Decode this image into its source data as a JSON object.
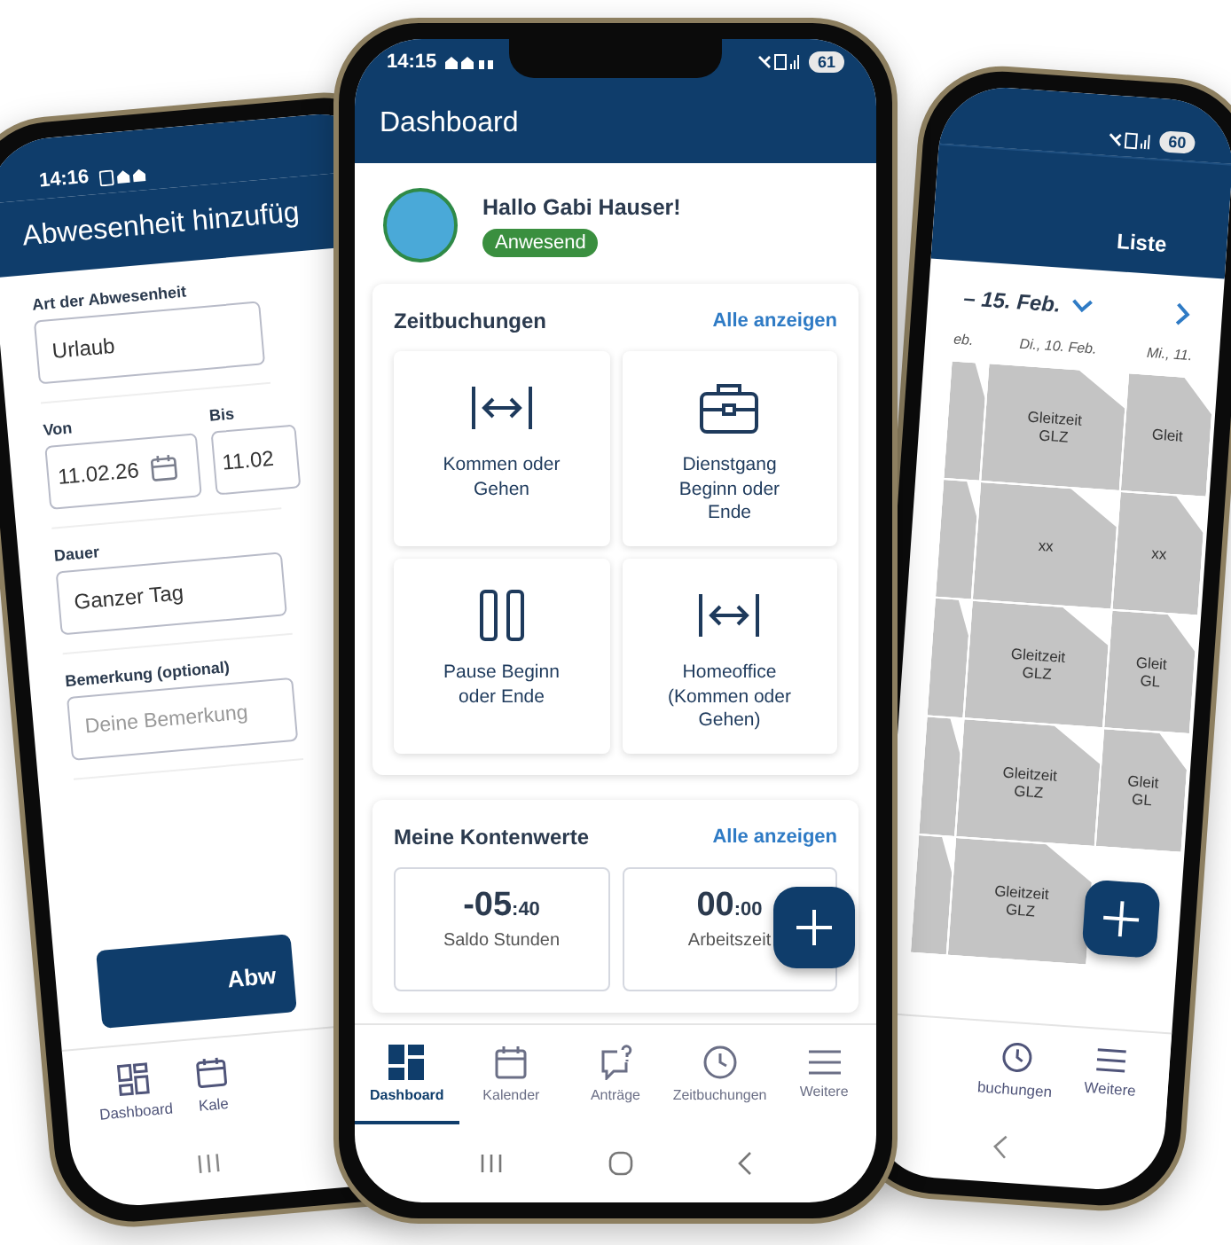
{
  "left_phone": {
    "status_time": "14:16",
    "title": "Abwesenheit hinzufüg",
    "field_rows": [
      [
        {
          "label": "Art der Abwesenheit",
          "value": "Urlaub",
          "kind": "text"
        }
      ],
      [
        {
          "label": "Von",
          "value": "11.02.26",
          "kind": "date"
        },
        {
          "label": "Bis",
          "value": "11.02",
          "kind": "text"
        }
      ],
      [
        {
          "label": "Dauer",
          "value": "Ganzer Tag",
          "kind": "text"
        }
      ],
      [
        {
          "label": "Bemerkung (optional)",
          "placeholder": "Deine Bemerkung"
        }
      ]
    ],
    "button": "Abw",
    "nav": [
      "Dashboard",
      "Kale"
    ]
  },
  "center_phone": {
    "status_time": "14:15",
    "battery": "61",
    "title": "Dashboard",
    "greeting": "Hallo Gabi Hauser!",
    "presence": "Anwesend",
    "sections": [
      {
        "kind": "actions",
        "title": "Zeitbuchungen",
        "link": "Alle anzeigen",
        "tiles": [
          "Kommen oder Gehen",
          "Dienstgang Beginn oder Ende",
          "Pause Beginn oder Ende",
          "Homeoffice (Kommen oder Gehen)"
        ]
      },
      {
        "kind": "values",
        "title": "Meine Kontenwerte",
        "link": "Alle anzeigen",
        "tiles": [
          {
            "hours": "-05",
            "minutes": ":40",
            "label": "Saldo Stunden"
          },
          {
            "hours": "00",
            "minutes": ":00",
            "label": "Arbeitszeit"
          }
        ]
      }
    ],
    "nav": [
      {
        "label": "Dashboard",
        "selected": true
      },
      {
        "label": "Kalender",
        "selected": false
      },
      {
        "label": "Anträge",
        "selected": false
      },
      {
        "label": "Zeitbuchungen",
        "selected": false
      },
      {
        "label": "Weitere",
        "selected": false
      }
    ]
  },
  "right_phone": {
    "battery": "60",
    "tab": "Liste",
    "range": "– 15. Feb.",
    "days": [
      "eb.",
      "Di., 10. Feb.",
      "Mi., 11."
    ],
    "rows": [
      [
        [],
        [
          "Gleitzeit",
          "GLZ"
        ],
        [
          "Gleit"
        ]
      ],
      [
        [],
        [
          "xx"
        ],
        [
          "xx"
        ]
      ],
      [
        [],
        [
          "Gleitzeit",
          "GLZ"
        ],
        [
          "Gleit",
          "GL"
        ]
      ],
      [
        [],
        [
          "Gleitzeit",
          "GLZ"
        ],
        [
          "Gleit",
          "GL"
        ]
      ],
      [
        [],
        [
          "Gleitzeit",
          "GLZ"
        ]
      ]
    ],
    "nav": [
      "buchungen",
      "Weitere"
    ]
  }
}
